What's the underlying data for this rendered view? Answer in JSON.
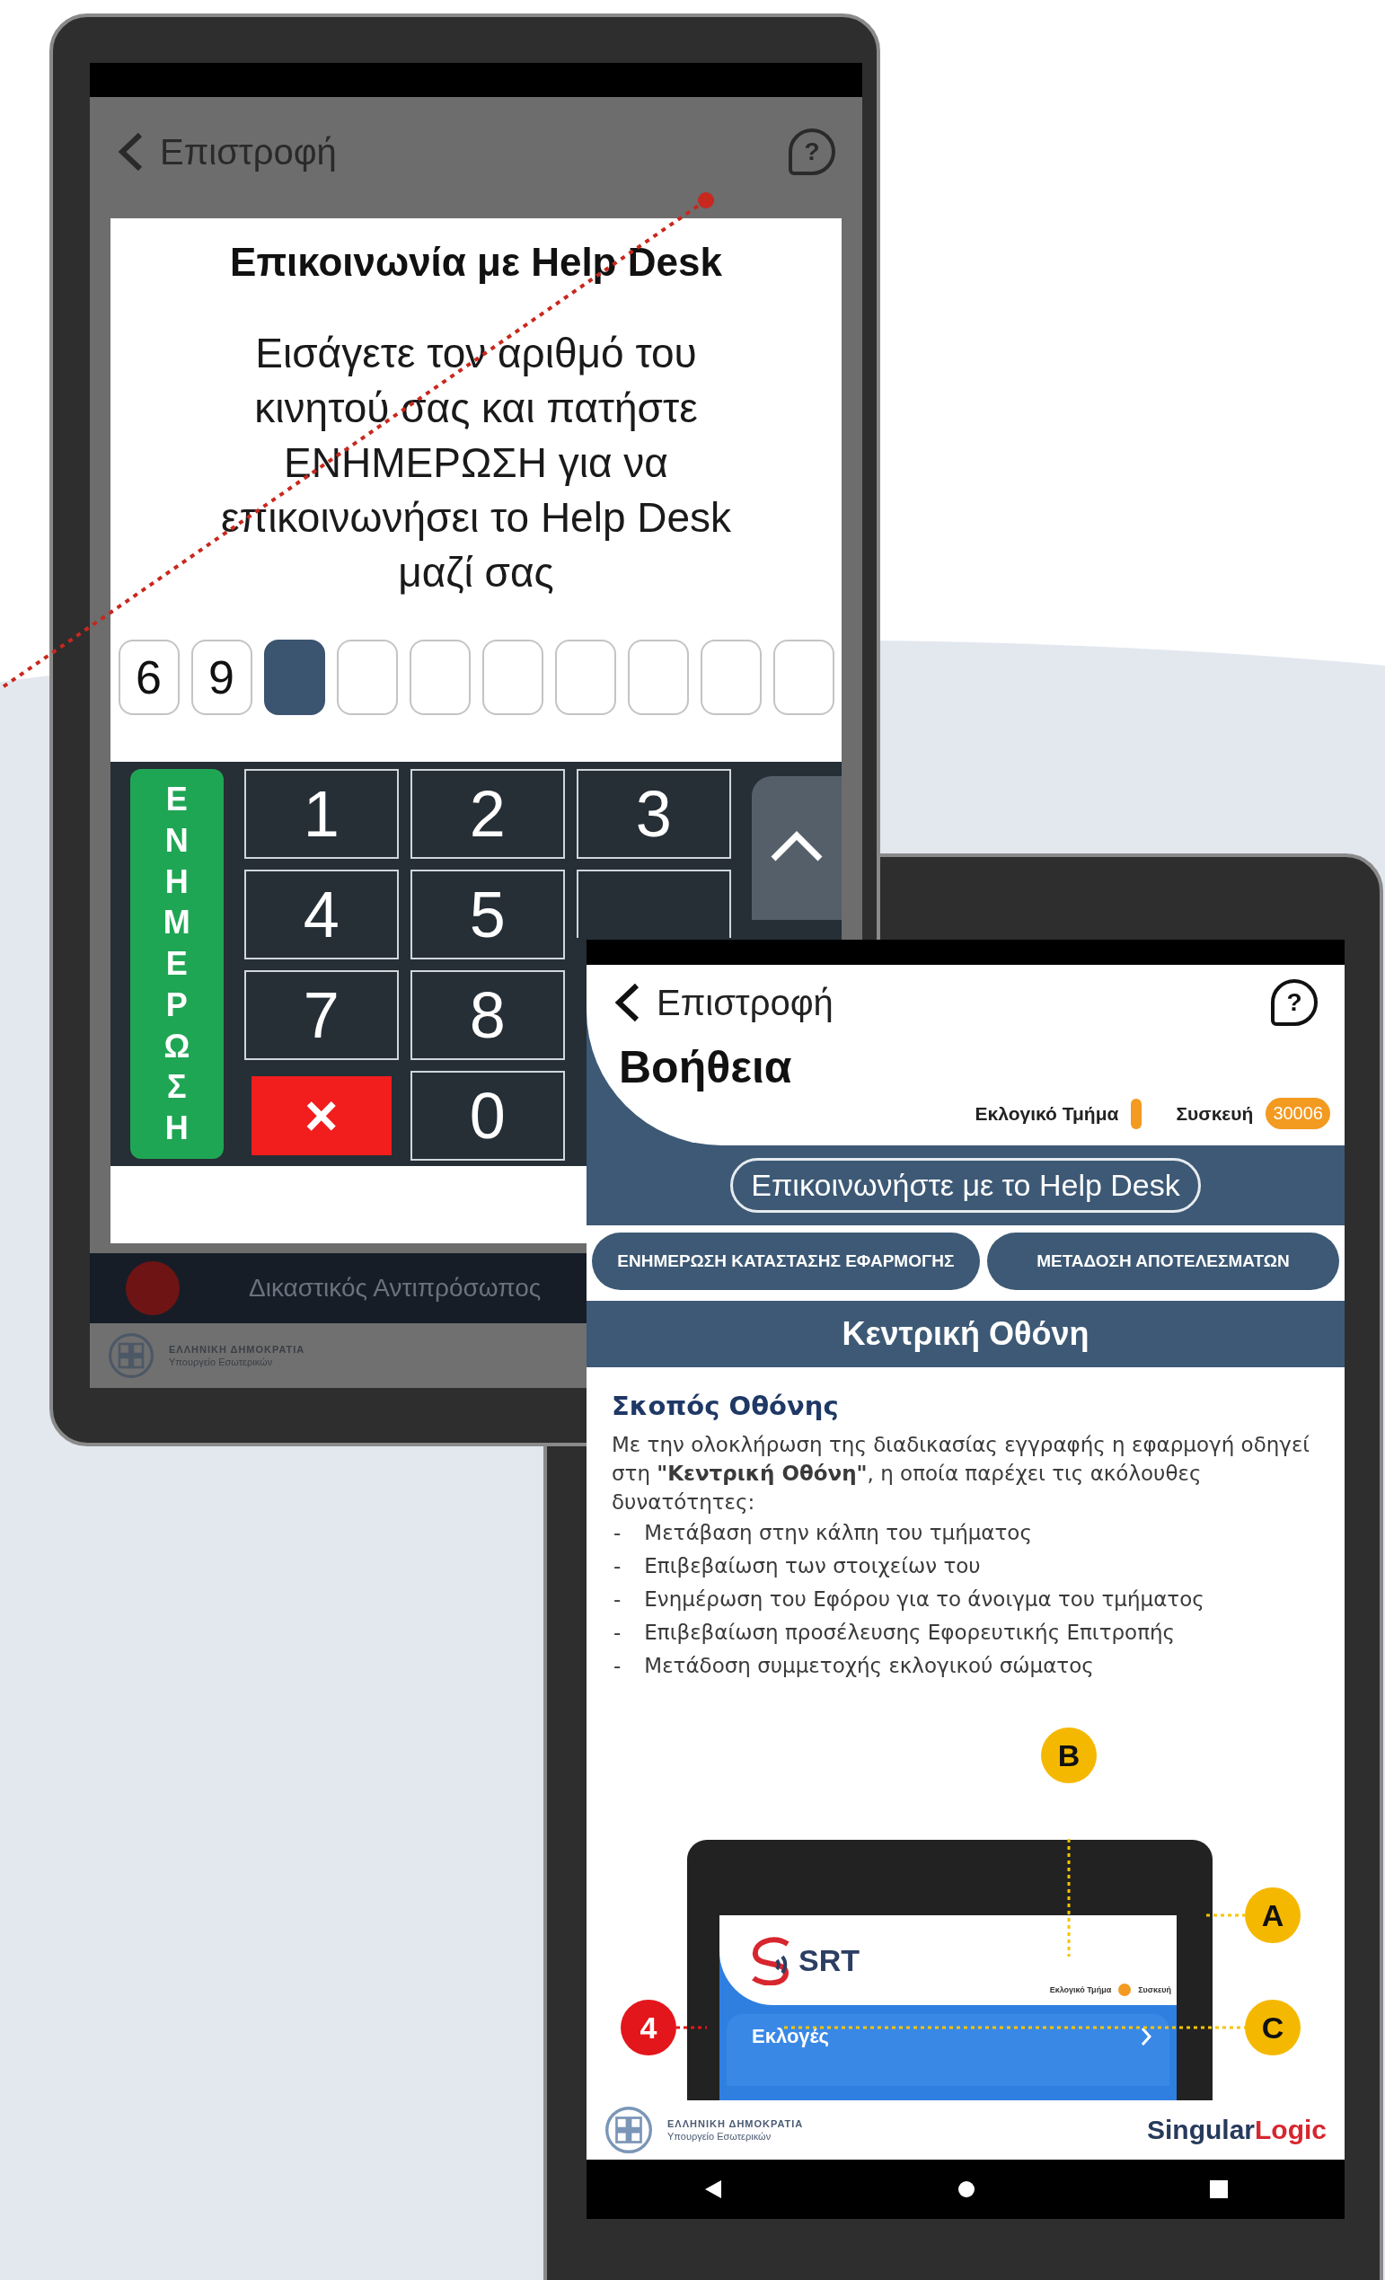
{
  "left_device": {
    "back_label": "Επιστροφή",
    "help_glyph": "?",
    "dialog": {
      "title": "Επικοινωνία με Help Desk",
      "message": "Εισάγετε τον αριθμό του κινητού σας και πατήστε ΕΝΗΜΕΡΩΣΗ για να επικοινωνήσει το Help Desk μαζί σας",
      "digits": [
        {
          "value": "6",
          "selected": false
        },
        {
          "value": "9",
          "selected": false
        },
        {
          "selected": true
        },
        {
          "selected": false
        },
        {
          "selected": false
        },
        {
          "selected": false
        },
        {
          "selected": false
        },
        {
          "selected": false
        },
        {
          "selected": false
        },
        {
          "selected": false
        }
      ],
      "submit_label": "ΕΝΗΜΕΡΩΣΗ",
      "keys": [
        {
          "kind": "digit",
          "label": "1"
        },
        {
          "kind": "digit",
          "label": "2"
        },
        {
          "kind": "digit",
          "label": "3"
        },
        {
          "kind": "digit",
          "label": "4"
        },
        {
          "kind": "digit",
          "label": "5"
        },
        {
          "kind": "partial"
        },
        {
          "kind": "digit",
          "label": "7"
        },
        {
          "kind": "digit",
          "label": "8"
        },
        {
          "kind": "covered"
        },
        {
          "kind": "delete",
          "label": "×"
        },
        {
          "kind": "digit",
          "label": "0"
        },
        {
          "kind": "covered"
        }
      ]
    },
    "background_row": "Δικαστικός Αντιπρόσωπος",
    "footer": {
      "line_1": "ΕΛΛΗΝΙΚΗ ΔΗΜΟΚΡΑΤΙΑ",
      "line_2": "Υπουργείο Εσωτερικών"
    }
  },
  "right_device": {
    "back_label": "Επιστροφή",
    "help_glyph": "?",
    "title": "Βοήθεια",
    "status": {
      "section_label": "Εκλογικό Τμήμα",
      "device_label": "Συσκευή",
      "device_value": "30006"
    },
    "helpdesk_button": "Επικοινωνήστε με το Help Desk",
    "action_buttons": [
      "ΕΝΗΜΕΡΩΣΗ ΚΑΤΑΣΤΑΣΗΣ ΕΦΑΡΜΟΓΗΣ",
      "ΜΕΤΑΔΟΣΗ ΑΠΟΤΕΛΕΣΜΑΤΩΝ"
    ],
    "section_title": "Κεντρική Οθόνη",
    "content": {
      "heading": "Σκοπός Οθόνης",
      "paragraph": "Με την ολοκλήρωση της διαδικασίας εγγραφής η εφαρμογή οδηγεί στη **\"Κεντρική Οθόνη\"**, η οποία παρέχει τις ακόλουθες δυνατότητες:",
      "items": [
        {
          "marker": "-",
          "text": "Μετάβαση στην κάλπη του τμήματος"
        },
        {
          "marker": "-",
          "text": "Επιβεβαίωση των στοιχείων του"
        },
        {
          "marker": "-",
          "text": "Ενημέρωση του Εφόρου για το άνοιγμα του τμήματος"
        },
        {
          "marker": "-",
          "text": "Επιβεβαίωση προσέλευσης Εφορευτικής Επιτροπής"
        },
        {
          "marker": "-",
          "text": "Μετάδοση συμμετοχής εκλογικού σώματος"
        }
      ]
    },
    "figure": {
      "logo_text": "SRT",
      "section_label": "Εκλογικό Τμήμα",
      "device_label": "Συσκευή",
      "menu_item": "Εκλογές",
      "callouts": [
        {
          "label": "B",
          "color": "#f5b800"
        },
        {
          "label": "A",
          "color": "#f5b800"
        },
        {
          "label": "C",
          "color": "#f5b800"
        },
        {
          "label": "4",
          "color": "#e3161b"
        }
      ]
    },
    "footer": {
      "line_1": "ΕΛΛΗΝΙΚΗ ΔΗΜΟΚΡΑΤΙΑ",
      "line_2": "Υπουργείο Εσωτερικών",
      "brand_1": "Singular",
      "brand_2": "Logic"
    }
  }
}
